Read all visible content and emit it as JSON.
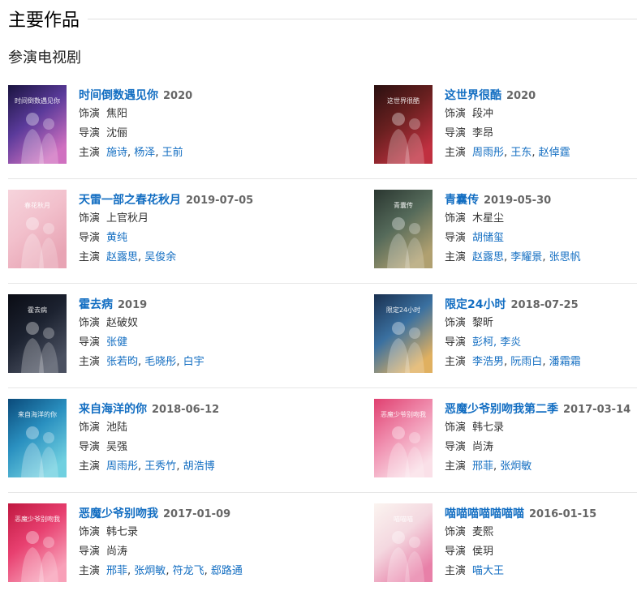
{
  "header": {
    "title": "主要作品",
    "subtitle": "参演电视剧"
  },
  "labels": {
    "role": "饰演",
    "director": "导演",
    "cast": "主演",
    "sep": ", "
  },
  "works": [
    {
      "title": "时间倒数遇见你",
      "year": "2020",
      "role": "焦阳",
      "director": "沈俪",
      "director_link": false,
      "cast": [
        "施诗",
        "杨泽",
        "王前"
      ],
      "poster_label": "时间倒数遇见你",
      "poster_colors": [
        "#1a1440",
        "#5a3a9a",
        "#d070c0"
      ]
    },
    {
      "title": "这世界很酷",
      "year": "2020",
      "role": "段冲",
      "director": "李昂",
      "director_link": false,
      "cast": [
        "周雨彤",
        "王东",
        "赵倬霆"
      ],
      "poster_label": "这世界很酷",
      "poster_colors": [
        "#2a1010",
        "#6a2020",
        "#c03040"
      ]
    },
    {
      "title": "天雷一部之春花秋月",
      "year": "2019-07-05",
      "role": "上官秋月",
      "director": "黄纯",
      "director_link": true,
      "cast": [
        "赵露思",
        "吴俊余"
      ],
      "poster_label": "春花秋月",
      "poster_colors": [
        "#f6d4dc",
        "#f2c0cc",
        "#e8a4b4"
      ]
    },
    {
      "title": "青囊传",
      "year": "2019-05-30",
      "role": "木星尘",
      "director": "胡储玺",
      "director_link": true,
      "cast": [
        "赵露思",
        "李耀景",
        "张思帆"
      ],
      "poster_label": "青囊传",
      "poster_colors": [
        "#2a3630",
        "#556a5a",
        "#b0a070"
      ]
    },
    {
      "title": "霍去病",
      "year": "2019",
      "role": "赵破奴",
      "director": "张健",
      "director_link": true,
      "cast": [
        "张若昀",
        "毛晓彤",
        "白宇"
      ],
      "poster_label": "霍去病",
      "poster_colors": [
        "#0a0c14",
        "#1c2230",
        "#4a5060"
      ]
    },
    {
      "title": "限定24小时",
      "year": "2018-07-25",
      "role": "黎昕",
      "director": "彭柯, 李炎",
      "director_link": true,
      "cast": [
        "李浩男",
        "阮雨白",
        "潘霜霜"
      ],
      "poster_label": "限定24小时",
      "poster_colors": [
        "#1a3050",
        "#3a70a0",
        "#e0b060"
      ]
    },
    {
      "title": "来自海洋的你",
      "year": "2018-06-12",
      "role": "池陆",
      "director": "吴强",
      "director_link": false,
      "cast": [
        "周雨彤",
        "王秀竹",
        "胡浩博"
      ],
      "poster_label": "来自海洋的你",
      "poster_colors": [
        "#0a4a7a",
        "#2a90c0",
        "#70d0e0"
      ]
    },
    {
      "title": "恶魔少爷别吻我第二季",
      "year": "2017-03-14",
      "role": "韩七录",
      "director": "尚涛",
      "director_link": false,
      "cast": [
        "邢菲",
        "张炯敏"
      ],
      "poster_label": "恶魔少爷别吻我",
      "poster_colors": [
        "#e04070",
        "#f090b0",
        "#fae0e8"
      ]
    },
    {
      "title": "恶魔少爷别吻我",
      "year": "2017-01-09",
      "role": "韩七录",
      "director": "尚涛",
      "director_link": false,
      "cast": [
        "邢菲",
        "张炯敏",
        "符龙飞",
        "郄路通"
      ],
      "poster_label": "恶魔少爷别吻我",
      "poster_colors": [
        "#c01840",
        "#e84070",
        "#f8a0b8"
      ]
    },
    {
      "title": "喵喵喵喵喵喵喵",
      "year": "2016-01-15",
      "role": "麦熙",
      "director": "侯玥",
      "director_link": false,
      "cast": [
        "喵大王"
      ],
      "poster_label": "喵喵喵",
      "poster_colors": [
        "#fbf4f0",
        "#f4d8e0",
        "#e880a8"
      ]
    }
  ]
}
